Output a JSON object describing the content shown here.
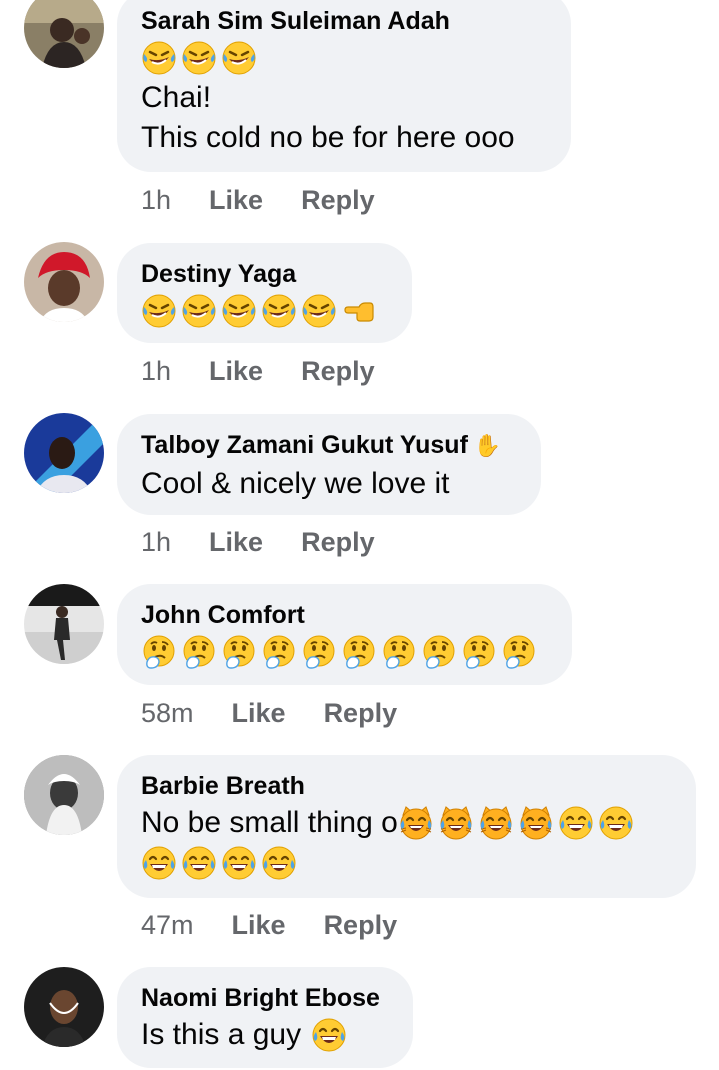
{
  "comments": [
    {
      "author": "Sarah Sim Suleiman Adah",
      "emojis": [
        "rofl-emoji",
        "rofl-emoji",
        "rofl-emoji"
      ],
      "lines": [
        "Chai!",
        "This cold no be for here ooo"
      ],
      "time": "1h",
      "like_label": "Like",
      "reply_label": "Reply"
    },
    {
      "author": "Destiny Yaga",
      "emojis": [
        "rofl-emoji",
        "rofl-emoji",
        "rofl-emoji",
        "rofl-emoji",
        "rofl-emoji",
        "pointing-left-hand-emoji"
      ],
      "time": "1h",
      "like_label": "Like",
      "reply_label": "Reply"
    },
    {
      "author": "Talboy Zamani Gukut Yusuf",
      "author_badge": "✋",
      "lines": [
        "Cool & nicely we love it"
      ],
      "time": "1h",
      "like_label": "Like",
      "reply_label": "Reply"
    },
    {
      "author": "John Comfort",
      "emojis": [
        "thinking-emoji",
        "thinking-emoji",
        "thinking-emoji",
        "thinking-emoji",
        "thinking-emoji",
        "thinking-emoji",
        "thinking-emoji",
        "thinking-emoji",
        "thinking-emoji",
        "thinking-emoji"
      ],
      "time": "58m",
      "like_label": "Like",
      "reply_label": "Reply"
    },
    {
      "author": "Barbie Breath",
      "text": "No be small thing o",
      "emojis_inline": [
        "cat-tears-of-joy-emoji",
        "cat-tears-of-joy-emoji",
        "cat-tears-of-joy-emoji",
        "cat-tears-of-joy-emoji",
        "tears-of-joy-emoji",
        "tears-of-joy-emoji"
      ],
      "emojis_second_row": [
        "tears-of-joy-emoji",
        "tears-of-joy-emoji",
        "tears-of-joy-emoji",
        "tears-of-joy-emoji"
      ],
      "time": "47m",
      "like_label": "Like",
      "reply_label": "Reply"
    },
    {
      "author": "Naomi Bright Ebose",
      "text": "Is this a guy",
      "emojis_inline": [
        "tears-of-joy-emoji"
      ]
    }
  ],
  "colors": {
    "bubble_bg": "#f0f2f5",
    "action_text": "#65676b",
    "text": "#050505",
    "emoji_yellow": "#ffcc33",
    "tear_blue": "#4fa3e6"
  }
}
